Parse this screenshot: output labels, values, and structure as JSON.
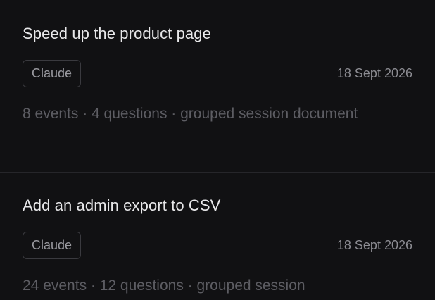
{
  "sessions": [
    {
      "title": "Speed up the product page",
      "tag": "Claude",
      "date": "18 Sept 2026",
      "meta": "8 events · 4 questions · grouped session document"
    },
    {
      "title": "Add an admin export to CSV",
      "tag": "Claude",
      "date": "18 Sept 2026",
      "meta": "24 events · 12 questions · grouped session"
    }
  ]
}
